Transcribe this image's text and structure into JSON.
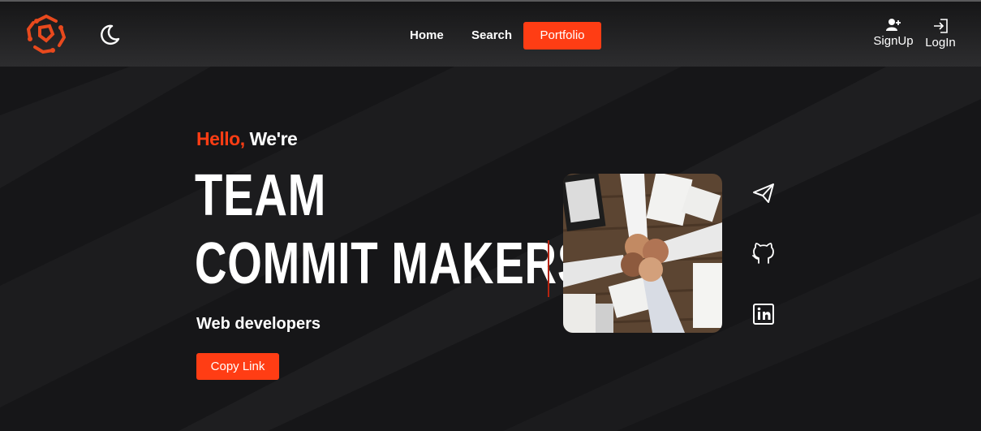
{
  "colors": {
    "accent": "#ff3d14",
    "background": "#161618",
    "header_bg": "#2d2d2f"
  },
  "header": {
    "logo_icon": "circuit-logo-icon",
    "theme_toggle_icon": "moon-icon",
    "nav": {
      "home": "Home",
      "search": "Search",
      "portfolio": "Portfolio"
    },
    "signup_label": "SignUp",
    "login_label": "LogIn"
  },
  "hero": {
    "greeting_accent": "Hello,",
    "greeting_rest": " We're",
    "title_line1": "TEAM",
    "title_line2": "COMMIT MAKERS",
    "subtitle": "Web developers",
    "copy_button": "Copy Link",
    "image_subject": "team-fist-bump-photo",
    "social_icons": [
      "telegram-icon",
      "github-icon",
      "linkedin-icon"
    ]
  }
}
